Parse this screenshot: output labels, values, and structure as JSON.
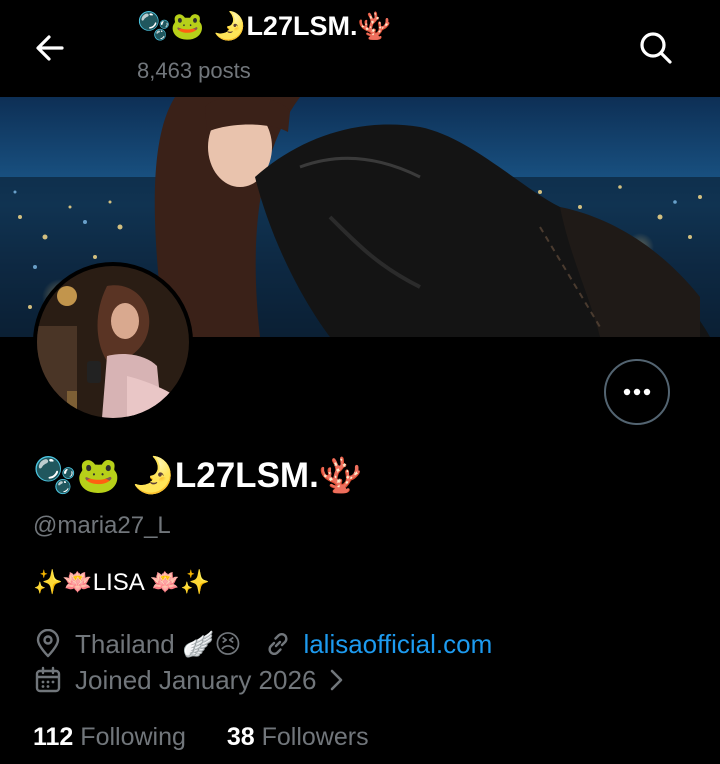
{
  "header": {
    "title_emoji_prefix": "🫧🐸 🌛",
    "title_name": "L27LSM.",
    "title_emoji_suffix": "🪸",
    "posts_count": "8,463 posts"
  },
  "profile": {
    "name_emoji_prefix": "🫧🐸 🌛",
    "name": "L27LSM.",
    "name_emoji_suffix": "🪸",
    "handle": "@maria27_L",
    "bio": "✨🪷LISA 🪷✨",
    "location": "Thailand 🪽😣",
    "website": "lalisaofficial.com",
    "joined": "Joined January 2026"
  },
  "stats": {
    "following_count": "112",
    "following_label": "Following",
    "followers_count": "38",
    "followers_label": "Followers"
  },
  "colors": {
    "background": "#000000",
    "link": "#1d9bf0",
    "muted": "#71767b"
  }
}
